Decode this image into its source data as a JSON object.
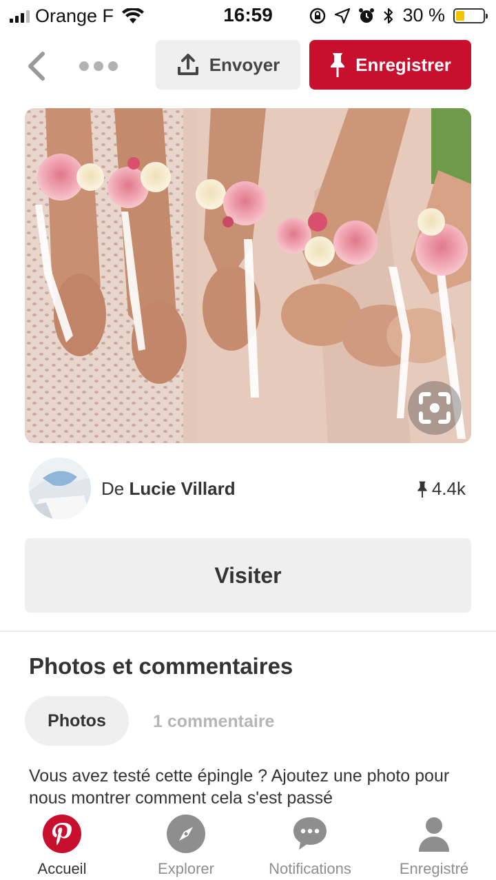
{
  "status_bar": {
    "carrier": "Orange F",
    "time": "16:59",
    "battery_percent": "30 %"
  },
  "top_bar": {
    "send_label": "Envoyer",
    "save_label": "Enregistrer"
  },
  "pin": {
    "author_prefix": "De",
    "author_name": "Lucie Villard",
    "save_count": "4.4k"
  },
  "visit": {
    "label": "Visiter"
  },
  "section": {
    "title": "Photos et commentaires",
    "tabs": [
      {
        "label": "Photos",
        "active": true
      },
      {
        "label": "1 commentaire",
        "active": false
      }
    ],
    "prompt": "Vous avez testé cette épingle ? Ajoutez une photo pour nous montrer comment cela s'est passé"
  },
  "bottom_nav": {
    "items": [
      {
        "label": "Accueil",
        "icon": "pinterest-logo-icon",
        "active": true
      },
      {
        "label": "Explorer",
        "icon": "compass-icon",
        "active": false
      },
      {
        "label": "Notifications",
        "icon": "speech-bubble-icon",
        "active": false
      },
      {
        "label": "Enregistré",
        "icon": "profile-icon",
        "active": false
      }
    ]
  },
  "colors": {
    "brand_red": "#c8102e",
    "button_gray": "#efefef",
    "text_dark": "#333333",
    "text_muted": "#b5b5b5"
  }
}
